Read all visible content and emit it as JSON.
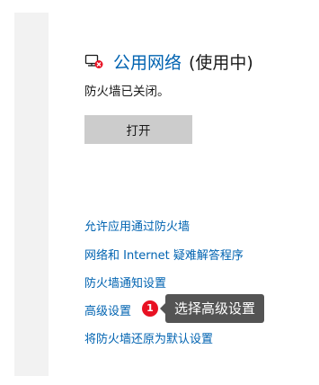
{
  "network": {
    "icon": "public-network-blocked-icon",
    "title": "公用网络",
    "status": "(使用中)",
    "firewall_state": "防火墙已关闭。"
  },
  "actions": {
    "open_label": "打开"
  },
  "links": [
    {
      "label": "允许应用通过防火墙"
    },
    {
      "label": "网络和 Internet 疑难解答程序"
    },
    {
      "label": "防火墙通知设置"
    },
    {
      "label": "高级设置"
    },
    {
      "label": "将防火墙还原为默认设置"
    }
  ],
  "annotation": {
    "step_number": "1",
    "callout_text": "选择高级设置",
    "badge_color": "#e81123",
    "callout_color": "#545454"
  },
  "colors": {
    "link": "#0063b1",
    "button_bg": "#cccccc",
    "nav_bg": "#f2f2f2"
  }
}
